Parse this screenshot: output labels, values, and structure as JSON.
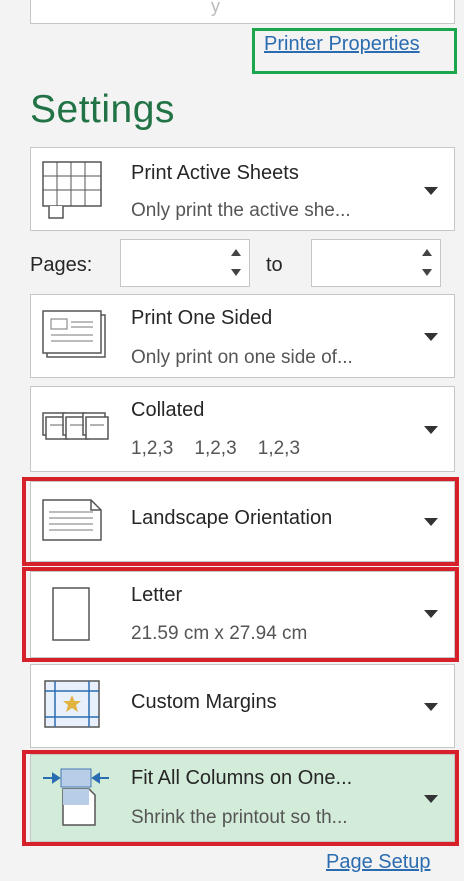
{
  "links": {
    "printer_properties": "Printer Properties",
    "page_setup": "Page Setup"
  },
  "settings": {
    "title": "Settings"
  },
  "pages": {
    "label": "Pages:",
    "to_label": "to",
    "from_value": "",
    "to_value": ""
  },
  "dropdowns": [
    {
      "main": "Print Active Sheets",
      "sub": "Only print the active she...",
      "icon": "sheet-grid-icon"
    },
    {
      "main": "Print One Sided",
      "sub": "Only print on one side of...",
      "icon": "one-sided-page-icon"
    },
    {
      "main": "Collated",
      "sub": "1,2,3    1,2,3    1,2,3",
      "icon": "collated-pages-icon"
    },
    {
      "main": "Landscape Orientation",
      "sub": "",
      "icon": "landscape-page-icon"
    },
    {
      "main": "Letter",
      "sub": "21.59 cm x 27.94 cm",
      "icon": "letter-page-icon"
    },
    {
      "main": "Custom Margins",
      "sub": "",
      "icon": "margins-icon"
    },
    {
      "main": "Fit All Columns on One...",
      "sub": "Shrink the printout so th...",
      "icon": "fit-columns-icon"
    }
  ],
  "colors": {
    "accent_green": "#217346",
    "highlight_green_border": "#1aa64a",
    "highlight_red_border": "#d6212a",
    "selected_bg": "#d3ecd9",
    "link_blue": "#2b6cb0"
  }
}
